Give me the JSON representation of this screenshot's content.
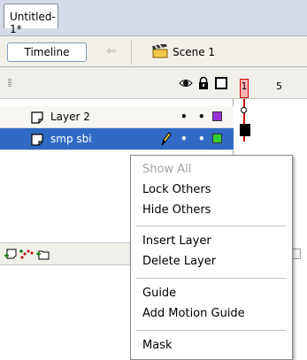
{
  "document_tab": {
    "title": "Untitled-1*"
  },
  "edit_bar": {
    "timeline_button": "Timeline",
    "back_icon": "back-arrow-icon",
    "scene_label": "Scene 1",
    "scene_icon": "clapperboard-icon"
  },
  "timeline": {
    "header_icons": [
      "eye-icon",
      "lock-icon",
      "outline-icon"
    ],
    "layers": [
      {
        "name": "Layer 2",
        "visible": "•",
        "locked": "•",
        "outline_color": "#9b30d8",
        "selected": false
      },
      {
        "name": "smp sbi",
        "visible": "•",
        "locked": "•",
        "outline_color": "#33cc33",
        "selected": true
      }
    ],
    "bottom_icons": [
      "insert-layer-icon",
      "add-motion-guide-icon",
      "insert-folder-icon"
    ],
    "ruler": {
      "current_frame": "1",
      "marker": "5"
    }
  },
  "context_menu": {
    "items": [
      {
        "label": "Show All",
        "enabled": false
      },
      {
        "label": "Lock Others",
        "enabled": true
      },
      {
        "label": "Hide Others",
        "enabled": true
      },
      {
        "label": "Insert Layer",
        "enabled": true
      },
      {
        "label": "Delete Layer",
        "enabled": true
      },
      {
        "label": "Guide",
        "enabled": true
      },
      {
        "label": "Add Motion Guide",
        "enabled": true
      },
      {
        "label": "Mask",
        "enabled": true
      }
    ]
  },
  "colors": {
    "selection": "#316ac5",
    "playhead": "#cc0000"
  }
}
